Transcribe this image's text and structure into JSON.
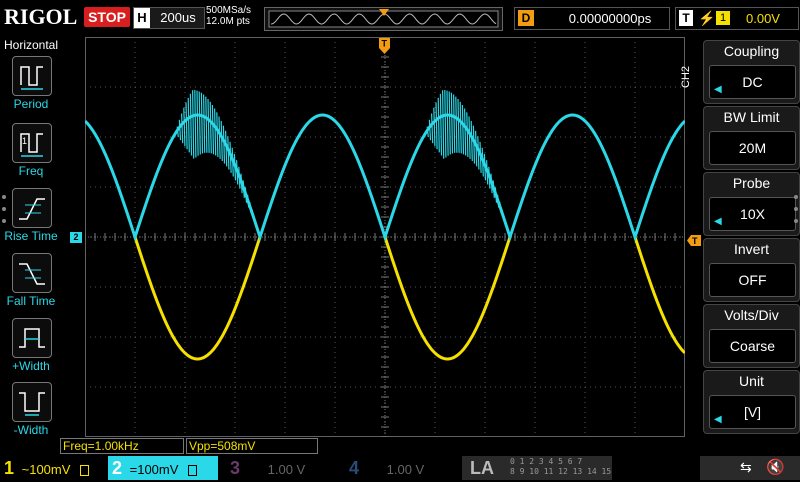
{
  "top_bar": {
    "logo": "RIGOL",
    "run_state": "STOP",
    "horizontal_label": "H",
    "timebase": "200us",
    "sample_rate": "500MSa/s",
    "memory_depth": "12.0M pts",
    "trigger_marker": "T",
    "delay_label": "D",
    "delay_value": "0.00000000ps",
    "trigger_label": "T",
    "trigger_source": "1",
    "trigger_level": "0.00V"
  },
  "left_menu": {
    "title": "Horizontal",
    "items": [
      {
        "label": "Period"
      },
      {
        "label": "Freq"
      },
      {
        "label": "Rise Time"
      },
      {
        "label": "Fall Time"
      },
      {
        "label": "+Width"
      },
      {
        "label": "-Width"
      }
    ]
  },
  "right_menu": {
    "channel_tag": "CH2",
    "items": [
      {
        "header": "Coupling",
        "value": "DC"
      },
      {
        "header": "BW Limit",
        "value": "20M"
      },
      {
        "header": "Probe",
        "value": "10X"
      },
      {
        "header": "Invert",
        "value": "OFF"
      },
      {
        "header": "Volts/Div",
        "value": "Coarse"
      },
      {
        "header": "Unit",
        "value": "[V]"
      }
    ]
  },
  "markers": {
    "ch2_marker": "2",
    "trigger_top": "T",
    "trigger_right": "T"
  },
  "measurements": {
    "freq": "Freq=1.00kHz",
    "vpp": "Vpp=508mV"
  },
  "bottom_bar": {
    "channels": [
      {
        "num": "1",
        "coupling": "~",
        "scale": "100mV",
        "color": "#f5e000"
      },
      {
        "num": "2",
        "coupling": "=",
        "scale": "100mV",
        "color": "#2bd8e8"
      },
      {
        "num": "3",
        "scale": "1.00 V",
        "color": "#c060c0"
      },
      {
        "num": "4",
        "scale": "1.00 V",
        "color": "#3070d0"
      }
    ],
    "la_label": "LA",
    "la_channels_row1": "0 1 2 3  4 5 6 7",
    "la_channels_row2": "8 9 10 11  12 13 14 15"
  },
  "colors": {
    "ch1": "#f5e000",
    "ch2": "#2bd8e8",
    "stop": "#d81f1f",
    "trigger": "#f39c12"
  },
  "icons": [
    "usb-icon",
    "speaker-mute-icon"
  ]
}
